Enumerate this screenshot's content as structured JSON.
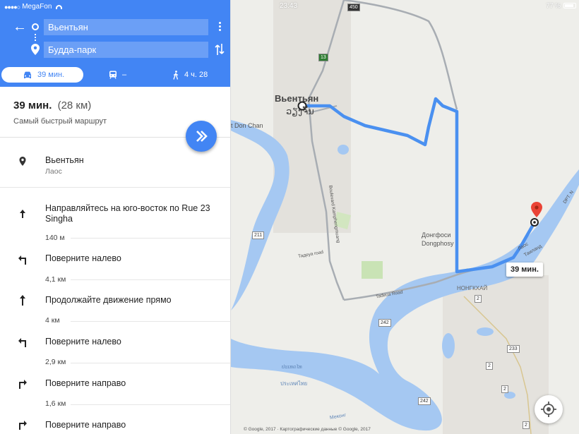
{
  "status": {
    "carrier": "MegaFon",
    "clock": "23:43",
    "battery": "77 %"
  },
  "search": {
    "origin": "Вьентьян",
    "destination": "Будда-парк"
  },
  "modes": {
    "car": "39 мин.",
    "transit": "–",
    "walk": "4 ч. 28"
  },
  "summary": {
    "time": "39 мин.",
    "distance": "(28 км)",
    "subtitle": "Самый быстрый маршрут"
  },
  "start": {
    "title": "Вьентьян",
    "subtitle": "Лаос"
  },
  "steps": [
    {
      "text": "Направляйтесь на юго-восток по Rue 23 Singha",
      "dist": "140 м",
      "icon": "straight-arrow-icon"
    },
    {
      "text": "Поверните налево",
      "dist": "4,1 км",
      "icon": "turn-left-icon"
    },
    {
      "text": "Продолжайте движение прямо",
      "dist": "4 км",
      "icon": "straight-arrow-icon"
    },
    {
      "text": "Поверните налево",
      "dist": "2,9 км",
      "icon": "turn-left-icon"
    },
    {
      "text": "Поверните направо",
      "dist": "1,6 км",
      "icon": "turn-right-icon"
    },
    {
      "text": "Поверните направо",
      "dist": "",
      "icon": "turn-right-icon"
    }
  ],
  "map": {
    "labels": {
      "vientiane": "Вьентьян",
      "vientiane_lao": "ວຽງຈັນ",
      "don_chan": "t Don Chan",
      "dongfosi": "Донгфоси",
      "dongphosy": "Dongphosy",
      "nongkhai": "НОНГКХАЙ",
      "mekong": "Меконг",
      "tadeua_road": "Tadeua Road",
      "thadeua": "Тадеуа road",
      "boulevard": "Boulevard Kamphengmuang",
      "laos": "Лаос",
      "thailand": "Таиланд",
      "dpt": "DPT. N",
      "laos_thai": "ประเทศไทย",
      "laos_lao": "ປະເທດໄທ"
    },
    "shields": [
      "450",
      "13",
      "211",
      "242",
      "2",
      "233",
      "2",
      "242",
      "2",
      "2"
    ],
    "route_time": "39 мин.",
    "copyright": "© Google, 2017 · Картографические данные © Google, 2017"
  },
  "colors": {
    "accent": "#4285f4",
    "route": "#4a90f0",
    "water": "#a5c8f2",
    "pin": "#ea4335"
  }
}
